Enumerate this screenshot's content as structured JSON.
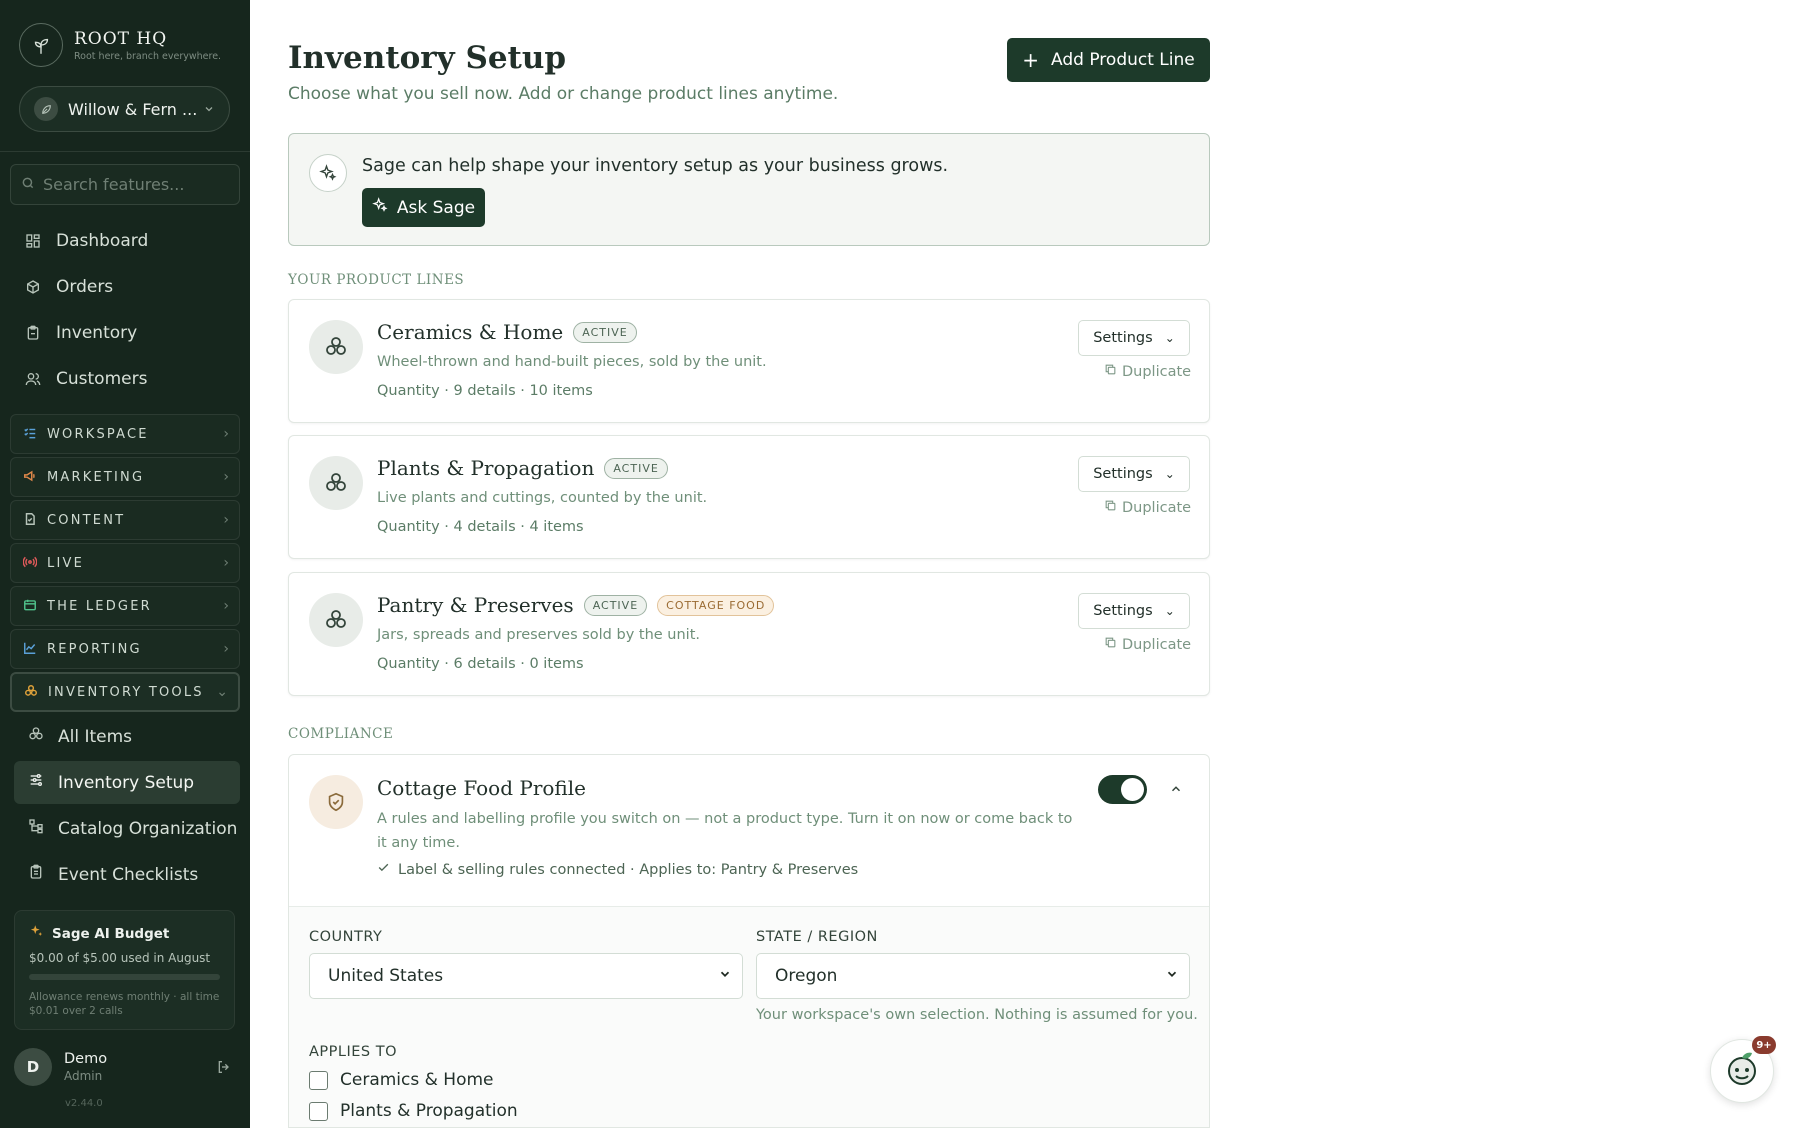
{
  "brand": {
    "name": "ROOT HQ",
    "tagline": "Root here, branch everywhere."
  },
  "workspace": {
    "name": "Willow & Fern ..."
  },
  "search": {
    "placeholder": "Search features..."
  },
  "nav": {
    "items": [
      {
        "label": "Dashboard",
        "icon": "grid-icon"
      },
      {
        "label": "Orders",
        "icon": "box-icon"
      },
      {
        "label": "Inventory",
        "icon": "clipboard-icon"
      },
      {
        "label": "Customers",
        "icon": "users-icon"
      }
    ]
  },
  "sections": [
    {
      "label": "WORKSPACE",
      "icon": "checklist-icon",
      "color": "#5aa0d8"
    },
    {
      "label": "MARKETING",
      "icon": "megaphone-icon",
      "color": "#e0884a"
    },
    {
      "label": "CONTENT",
      "icon": "document-icon",
      "color": "#b7c4ba"
    },
    {
      "label": "LIVE",
      "icon": "broadcast-icon",
      "color": "#e05a5a"
    },
    {
      "label": "THE LEDGER",
      "icon": "ledger-icon",
      "color": "#4fc08a"
    },
    {
      "label": "REPORTING",
      "icon": "line-chart-icon",
      "color": "#5aa0d8"
    },
    {
      "label": "INVENTORY TOOLS",
      "icon": "stack-icon",
      "color": "#e0a23a"
    }
  ],
  "subnav": [
    {
      "label": "All Items"
    },
    {
      "label": "Inventory Setup"
    },
    {
      "label": "Catalog Organization"
    },
    {
      "label": "Event Checklists"
    }
  ],
  "budget": {
    "title": "Sage AI Budget",
    "used": "$0.00 of $5.00 used in August",
    "used_fraction": 0.0,
    "note": "Allowance renews monthly · all time $0.01 over 2 calls"
  },
  "user": {
    "initial": "D",
    "name": "Demo",
    "role": "Admin"
  },
  "version": "v2.44.0",
  "page": {
    "title": "Inventory Setup",
    "subtitle": "Choose what you sell now. Add or change product lines anytime.",
    "add_label": "Add Product Line"
  },
  "sage": {
    "message": "Sage can help shape your inventory setup as your business grows.",
    "button": "Ask Sage"
  },
  "product_lines_label": "YOUR PRODUCT LINES",
  "products": [
    {
      "name": "Ceramics & Home",
      "badges": [
        "ACTIVE"
      ],
      "description": "Wheel-thrown and hand-built pieces, sold by the unit.",
      "meta": "Quantity · 9 details · 10 items",
      "settings": "Settings",
      "duplicate": "Duplicate"
    },
    {
      "name": "Plants & Propagation",
      "badges": [
        "ACTIVE"
      ],
      "description": "Live plants and cuttings, counted by the unit.",
      "meta": "Quantity · 4 details · 4 items",
      "settings": "Settings",
      "duplicate": "Duplicate"
    },
    {
      "name": "Pantry & Preserves",
      "badges": [
        "ACTIVE",
        "COTTAGE FOOD"
      ],
      "description": "Jars, spreads and preserves sold by the unit.",
      "meta": "Quantity · 6 details · 0 items",
      "settings": "Settings",
      "duplicate": "Duplicate"
    }
  ],
  "compliance_label": "COMPLIANCE",
  "cottage": {
    "title": "Cottage Food Profile",
    "description": "A rules and labelling profile you switch on — not a product type. Turn it on now or come back to it any time.",
    "status": "Label & selling rules connected · Applies to: Pantry & Preserves",
    "country_label": "COUNTRY",
    "country_value": "United States",
    "state_label": "STATE / REGION",
    "state_value": "Oregon",
    "hint": "Your workspace's own selection. Nothing is assumed for you.",
    "applies_label": "APPLIES TO",
    "applies": [
      {
        "label": "Ceramics & Home"
      },
      {
        "label": "Plants & Propagation"
      }
    ]
  },
  "chat": {
    "badge": "9+"
  },
  "colors": {
    "sidebar_bg": "#16261d",
    "primary": "#1d3a2a",
    "accent_text": "#5b7c66"
  }
}
